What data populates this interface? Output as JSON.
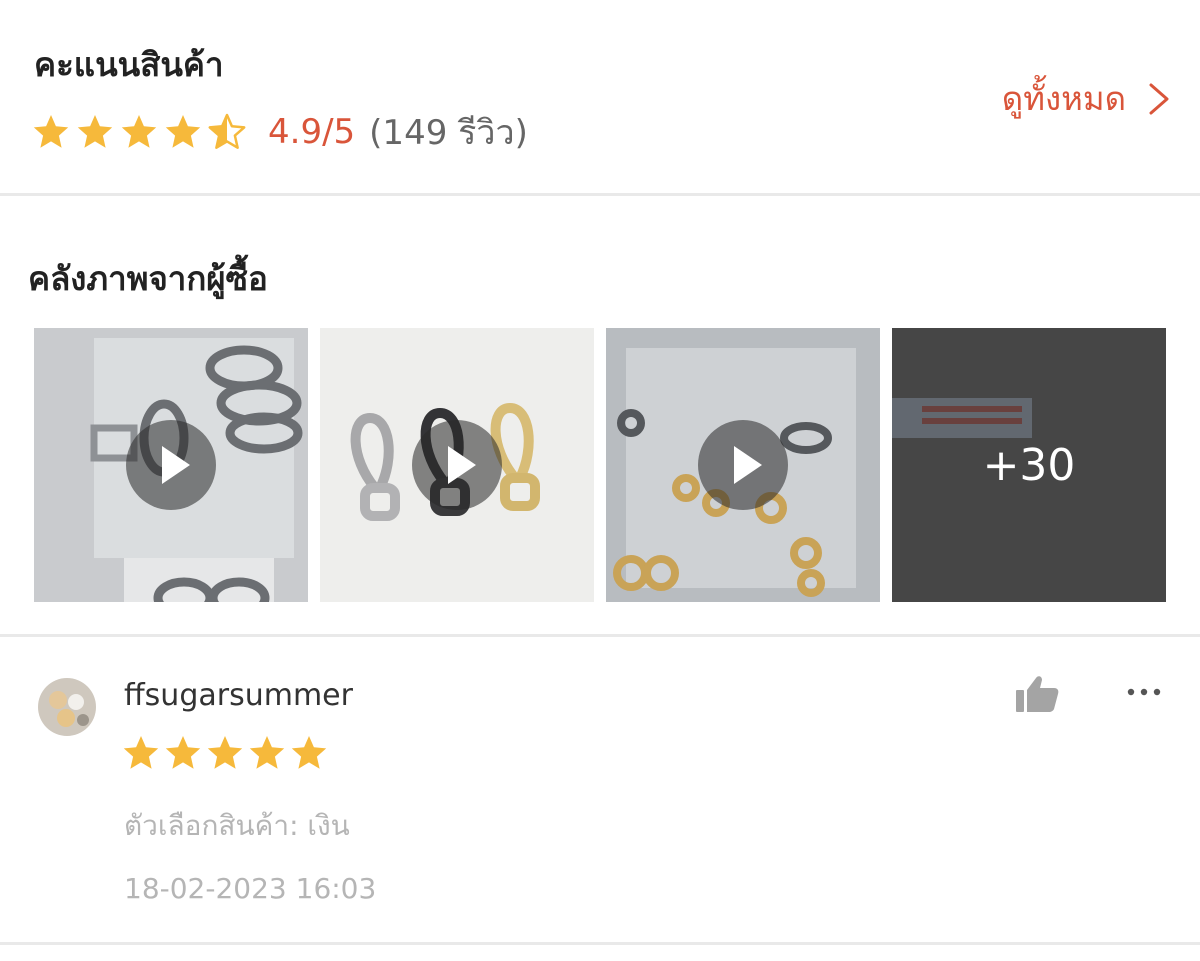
{
  "rating_section": {
    "title": "คะแนนสินค้า",
    "stars": 4.5,
    "score_text": "4.9/5",
    "review_count_text": "(149 รีวิว)",
    "see_all_label": "ดูทั้งหมด",
    "see_all_icon": "chevron-right-icon"
  },
  "gallery_section": {
    "title": "คลังภาพจากผู้ซื้อ",
    "items": [
      {
        "type": "video",
        "icon": "play-icon"
      },
      {
        "type": "video",
        "icon": "play-icon"
      },
      {
        "type": "video",
        "icon": "play-icon"
      },
      {
        "type": "more",
        "label": "+30"
      }
    ]
  },
  "review": {
    "username": "ffsugarsummer",
    "stars": 5,
    "variation": "ตัวเลือกสินค้า: เงิน",
    "date": "18-02-2023 16:03",
    "like_icon": "thumbs-up-icon",
    "more_icon": "more-dots-icon"
  },
  "colors": {
    "accent": "#d9553a",
    "star": "#f6b93b",
    "muted_text": "#b5b5b5",
    "divider": "#e9e9e9"
  }
}
